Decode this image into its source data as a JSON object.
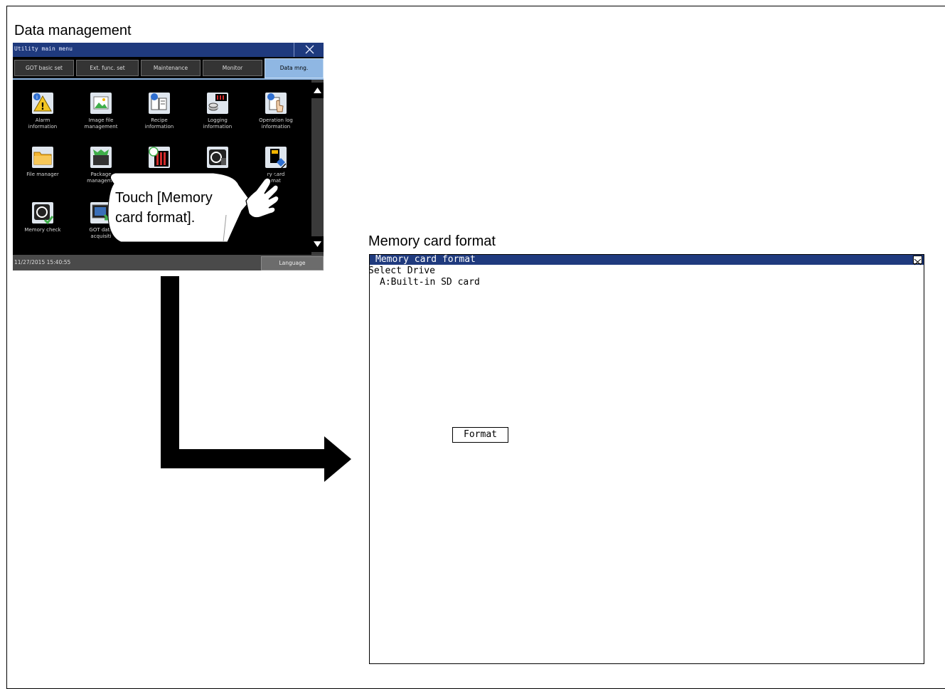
{
  "captions": {
    "data_management": "Data management",
    "memory_card_format": "Memory card format"
  },
  "utility_menu": {
    "title": "Utility main menu",
    "tabs": [
      {
        "label": "GOT basic set",
        "active": false
      },
      {
        "label": "Ext. func. set",
        "active": false
      },
      {
        "label": "Maintenance",
        "active": false
      },
      {
        "label": "Monitor",
        "active": false
      },
      {
        "label": "Data mng.",
        "active": true
      }
    ],
    "items": [
      {
        "label_1": "Alarm",
        "label_2": "information",
        "icon": "alarm-icon"
      },
      {
        "label_1": "Image file",
        "label_2": "management",
        "icon": "image-file-icon"
      },
      {
        "label_1": "Recipe",
        "label_2": "information",
        "icon": "recipe-icon"
      },
      {
        "label_1": "Logging",
        "label_2": "information",
        "icon": "logging-icon"
      },
      {
        "label_1": "Operation log",
        "label_2": "information",
        "icon": "operation-log-icon"
      },
      {
        "label_1": "File manager",
        "label_2": "",
        "icon": "file-manager-icon"
      },
      {
        "label_1": "Package",
        "label_2": "manageme",
        "icon": "package-icon"
      },
      {
        "label_1": "",
        "label_2": "",
        "icon": "time-icon"
      },
      {
        "label_1": "",
        "label_2": "",
        "icon": "sd-check-icon"
      },
      {
        "label_1": "ry card",
        "label_2": "mat",
        "icon": "memory-card-icon"
      },
      {
        "label_1": "Memory check",
        "label_2": "",
        "icon": "memory-check-icon"
      },
      {
        "label_1": "GOT data",
        "label_2": "acquisiti",
        "icon": "got-data-icon"
      }
    ],
    "status": {
      "datetime": "11/27/2015 15:40:55",
      "language_button": "Language"
    }
  },
  "instruction": {
    "line_1": "Touch [Memory",
    "line_2": "card format]."
  },
  "memory_card_format": {
    "title": "Memory card format",
    "select_drive": "Select Drive",
    "drive": "A:Built-in SD card",
    "format_button": "Format"
  },
  "colors": {
    "title_bar": "#1f3a7e",
    "active_tab": "#8fb7e3",
    "screen_bg": "#000000"
  }
}
